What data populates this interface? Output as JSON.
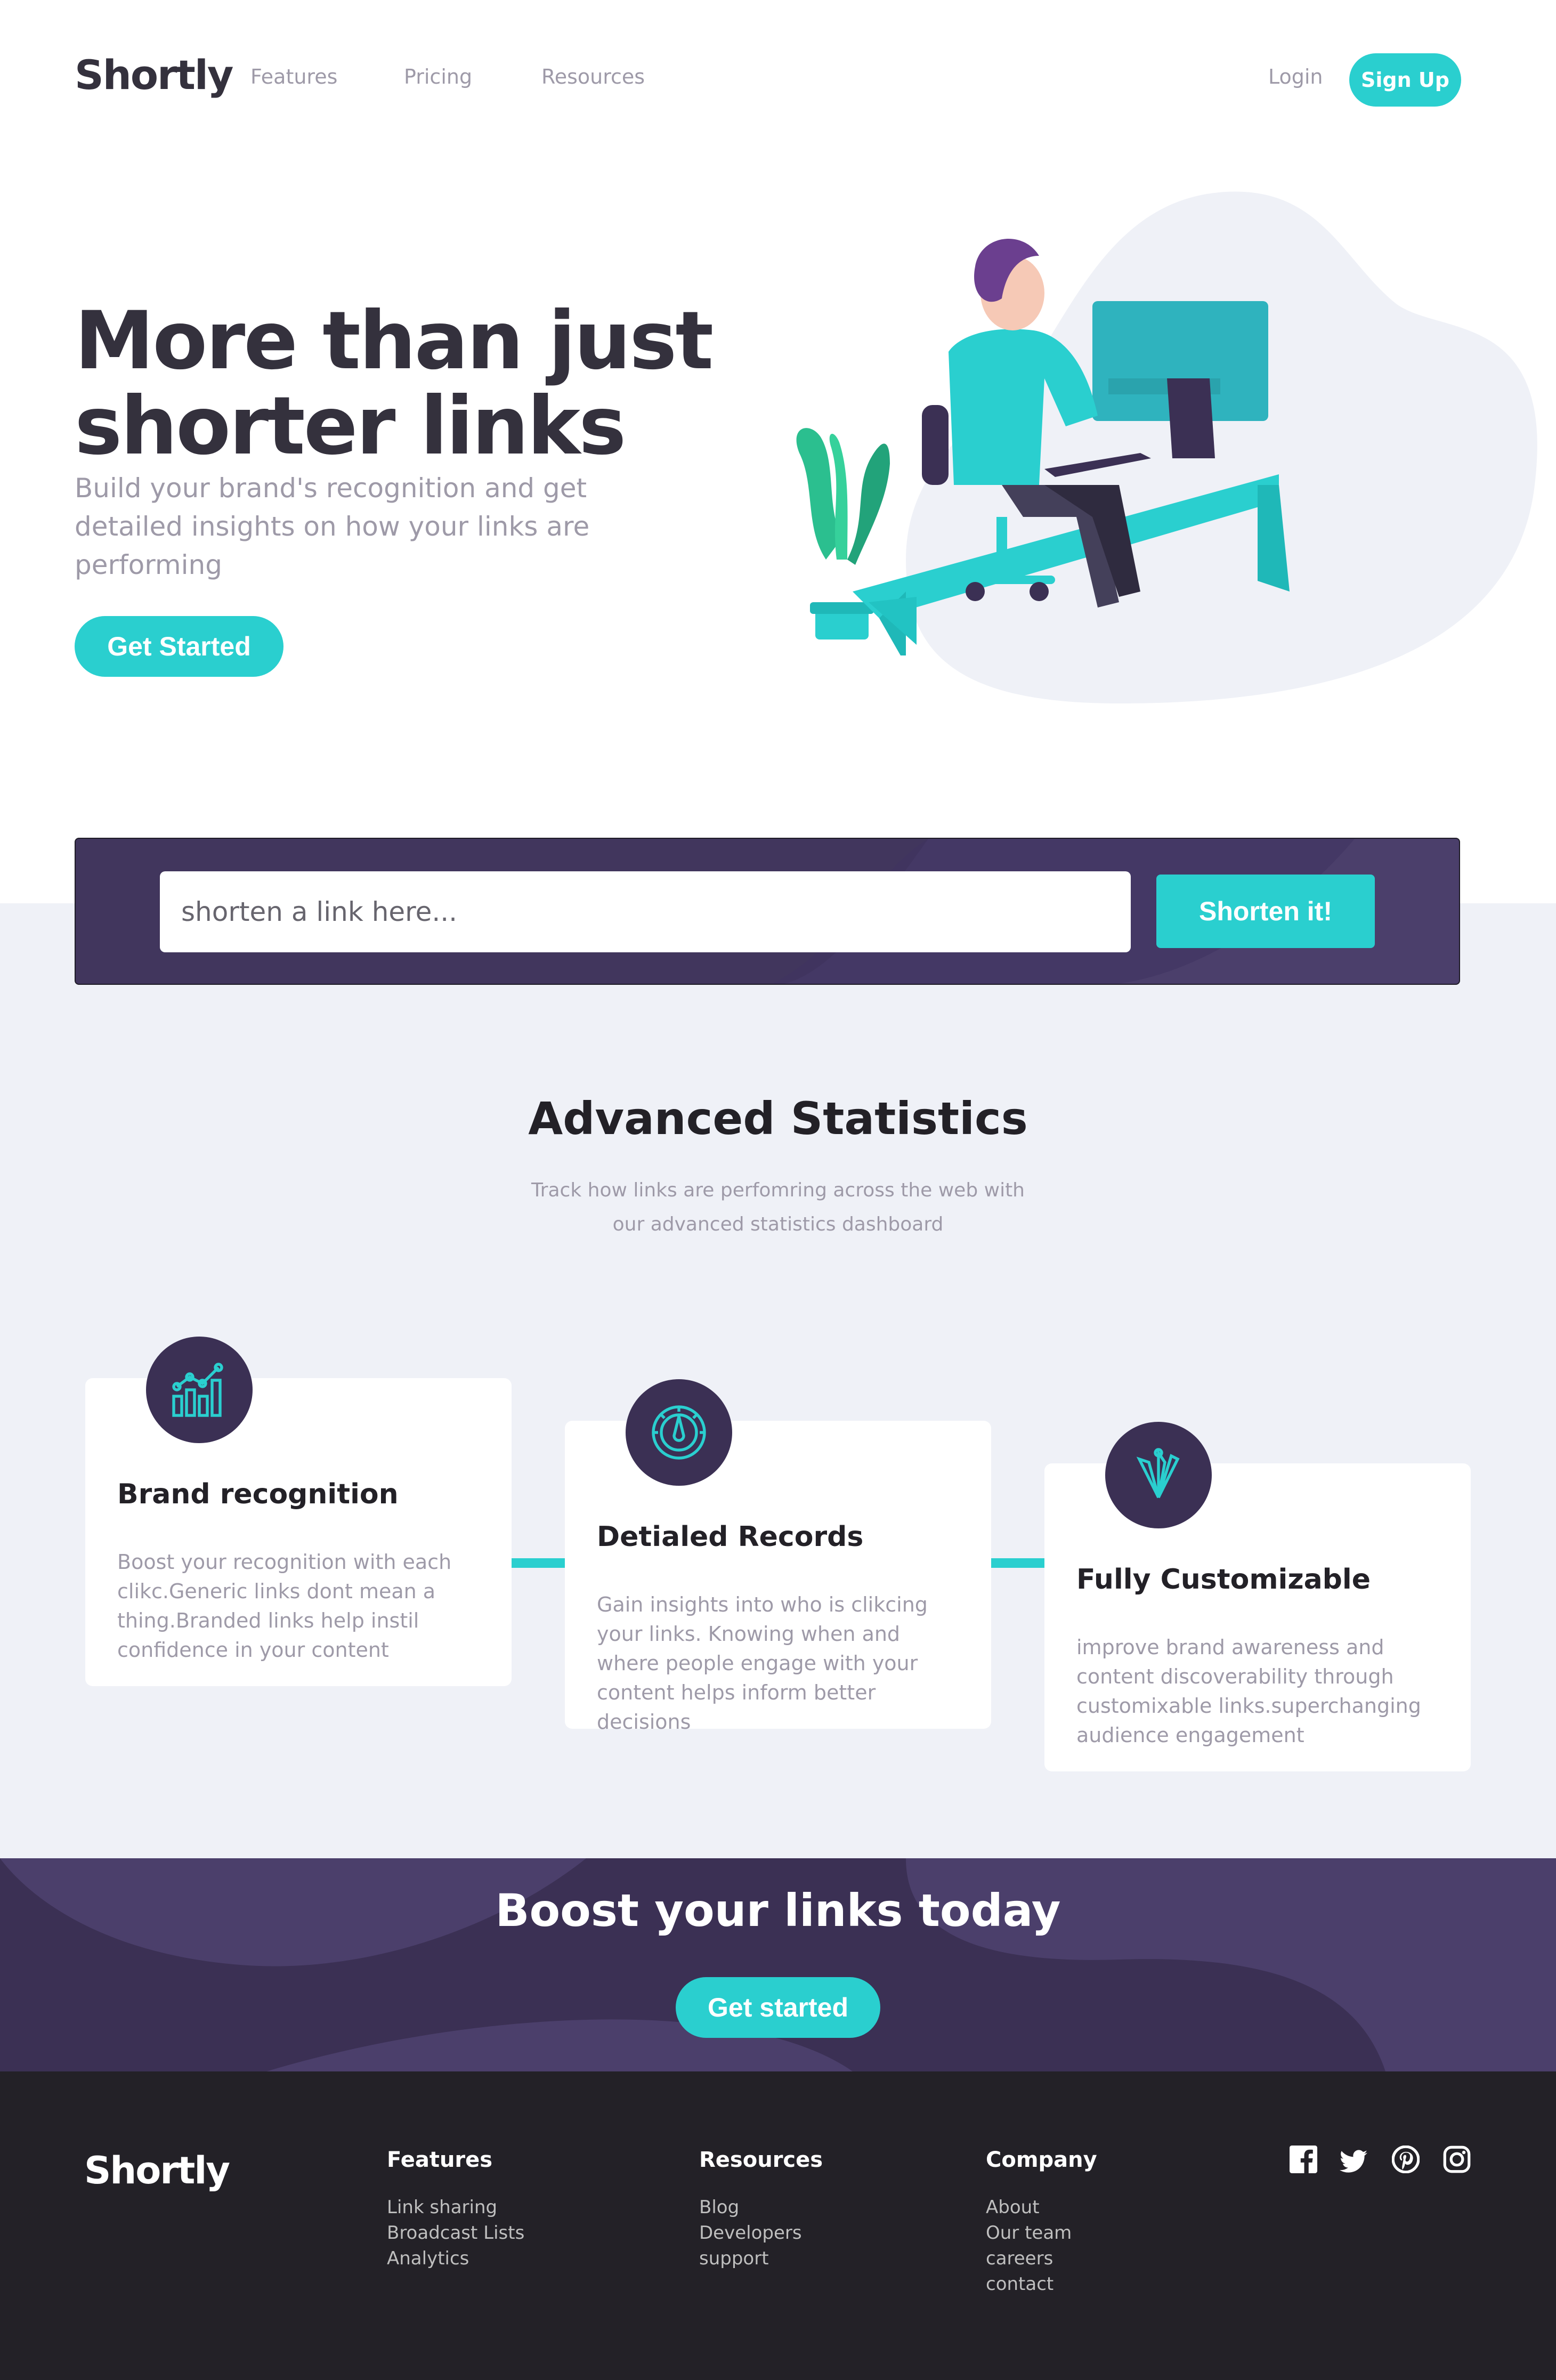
{
  "header": {
    "logo": "Shortly",
    "nav": [
      "Features",
      "Pricing",
      "Resources"
    ],
    "login": "Login",
    "signup": "Sign Up"
  },
  "hero": {
    "title_line1": "More than just",
    "title_line2": "shorter links",
    "subtitle": "Build your brand's recognition and get detailed insights on how your links are performing",
    "cta": "Get Started"
  },
  "shorten": {
    "placeholder": "shorten a link here...",
    "button": "Shorten it!"
  },
  "statistics": {
    "title": "Advanced Statistics",
    "subtitle_line1": "Track how links are perfomring across the web with",
    "subtitle_line2": "our advanced statistics dashboard",
    "cards": [
      {
        "icon": "brand-recognition-icon",
        "title": "Brand recognition",
        "text": "Boost your recognition with each clikc.Generic links dont mean a thing.Branded links help instil confidence in your content"
      },
      {
        "icon": "detailed-records-icon",
        "title": "Detialed Records",
        "text": "Gain insights into who is clikcing your links. Knowing when and where people engage with your content helps inform better decisions"
      },
      {
        "icon": "fully-customizable-icon",
        "title": "Fully Customizable",
        "text": "improve brand awareness and content discoverability through customixable links.superchanging audience engagement"
      }
    ]
  },
  "boost": {
    "title": "Boost your links today",
    "cta": "Get started"
  },
  "footer": {
    "logo": "Shortly",
    "columns": [
      {
        "heading": "Features",
        "links": [
          "Link sharing",
          "Broadcast Lists",
          "Analytics"
        ]
      },
      {
        "heading": "Resources",
        "links": [
          "Blog",
          "Developers",
          "support"
        ]
      },
      {
        "heading": "Company",
        "links": [
          "About",
          "Our team",
          "careers",
          "contact"
        ]
      }
    ],
    "social": [
      "facebook-icon",
      "twitter-icon",
      "pinterest-icon",
      "instagram-icon"
    ]
  },
  "colors": {
    "accent": "#2acfcf",
    "dark_violet": "#3b3054",
    "very_dark": "#232127",
    "grey_text": "#9e9aa8",
    "light_bg": "#eff1f7"
  }
}
